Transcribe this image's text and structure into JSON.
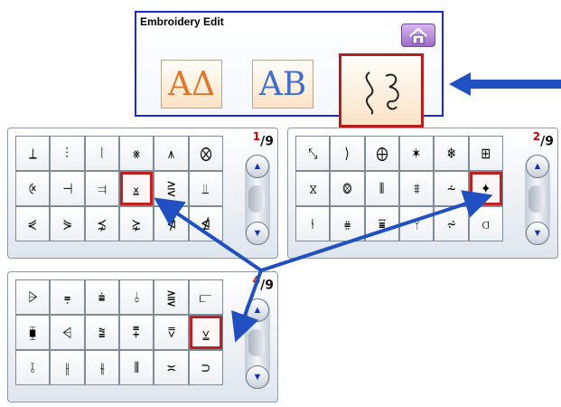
{
  "top_panel": {
    "title": "Embroidery Edit",
    "mode_buttons": [
      {
        "label": "AΔ"
      },
      {
        "label": "AB"
      },
      {
        "label": "∂ℓ"
      }
    ]
  },
  "panels": [
    {
      "page_top": "1",
      "page_bottom": "9",
      "cells": [
        "⟂",
        "⫶",
        "⦚",
        "⨳",
        "⩚",
        "⨂",
        "⨴",
        "⊣",
        "⫤",
        "⨱",
        "⋛",
        "⫫",
        "⋞",
        "⋟",
        "⋨",
        "⋩",
        "⋪",
        "⋬"
      ]
    },
    {
      "page_top": "2",
      "page_bottom": "9",
      "cells": [
        "⤡",
        "⟩",
        "⨁",
        "✶",
        "❄",
        "⊞",
        "⧖",
        "⨷",
        "⦀",
        "⩨",
        "⩪",
        "✦",
        "⫮",
        "⩷",
        "⩸",
        "⫯",
        "⩫",
        "⫏"
      ]
    },
    {
      "page_top": "4",
      "page_bottom": "9",
      "cells": [
        "⩥",
        "⩦",
        "⩧",
        "⫰",
        "⪌",
        "⫍",
        "⧯",
        "⩤",
        "⩰",
        "⩱",
        "⩢",
        "⩣",
        "⫱",
        "⫲",
        "⫳",
        "⫴",
        "≍",
        "⊃"
      ]
    }
  ],
  "colors": {
    "arrow_blue": "#1f4fc0",
    "highlight_red": "#c02020",
    "frame_blue": "#1a27d8",
    "home_purple": "#9f6cc8"
  },
  "icons": {
    "home": "home-icon",
    "scroll_up": "chevron-up-icon",
    "scroll_down": "chevron-down-icon"
  }
}
